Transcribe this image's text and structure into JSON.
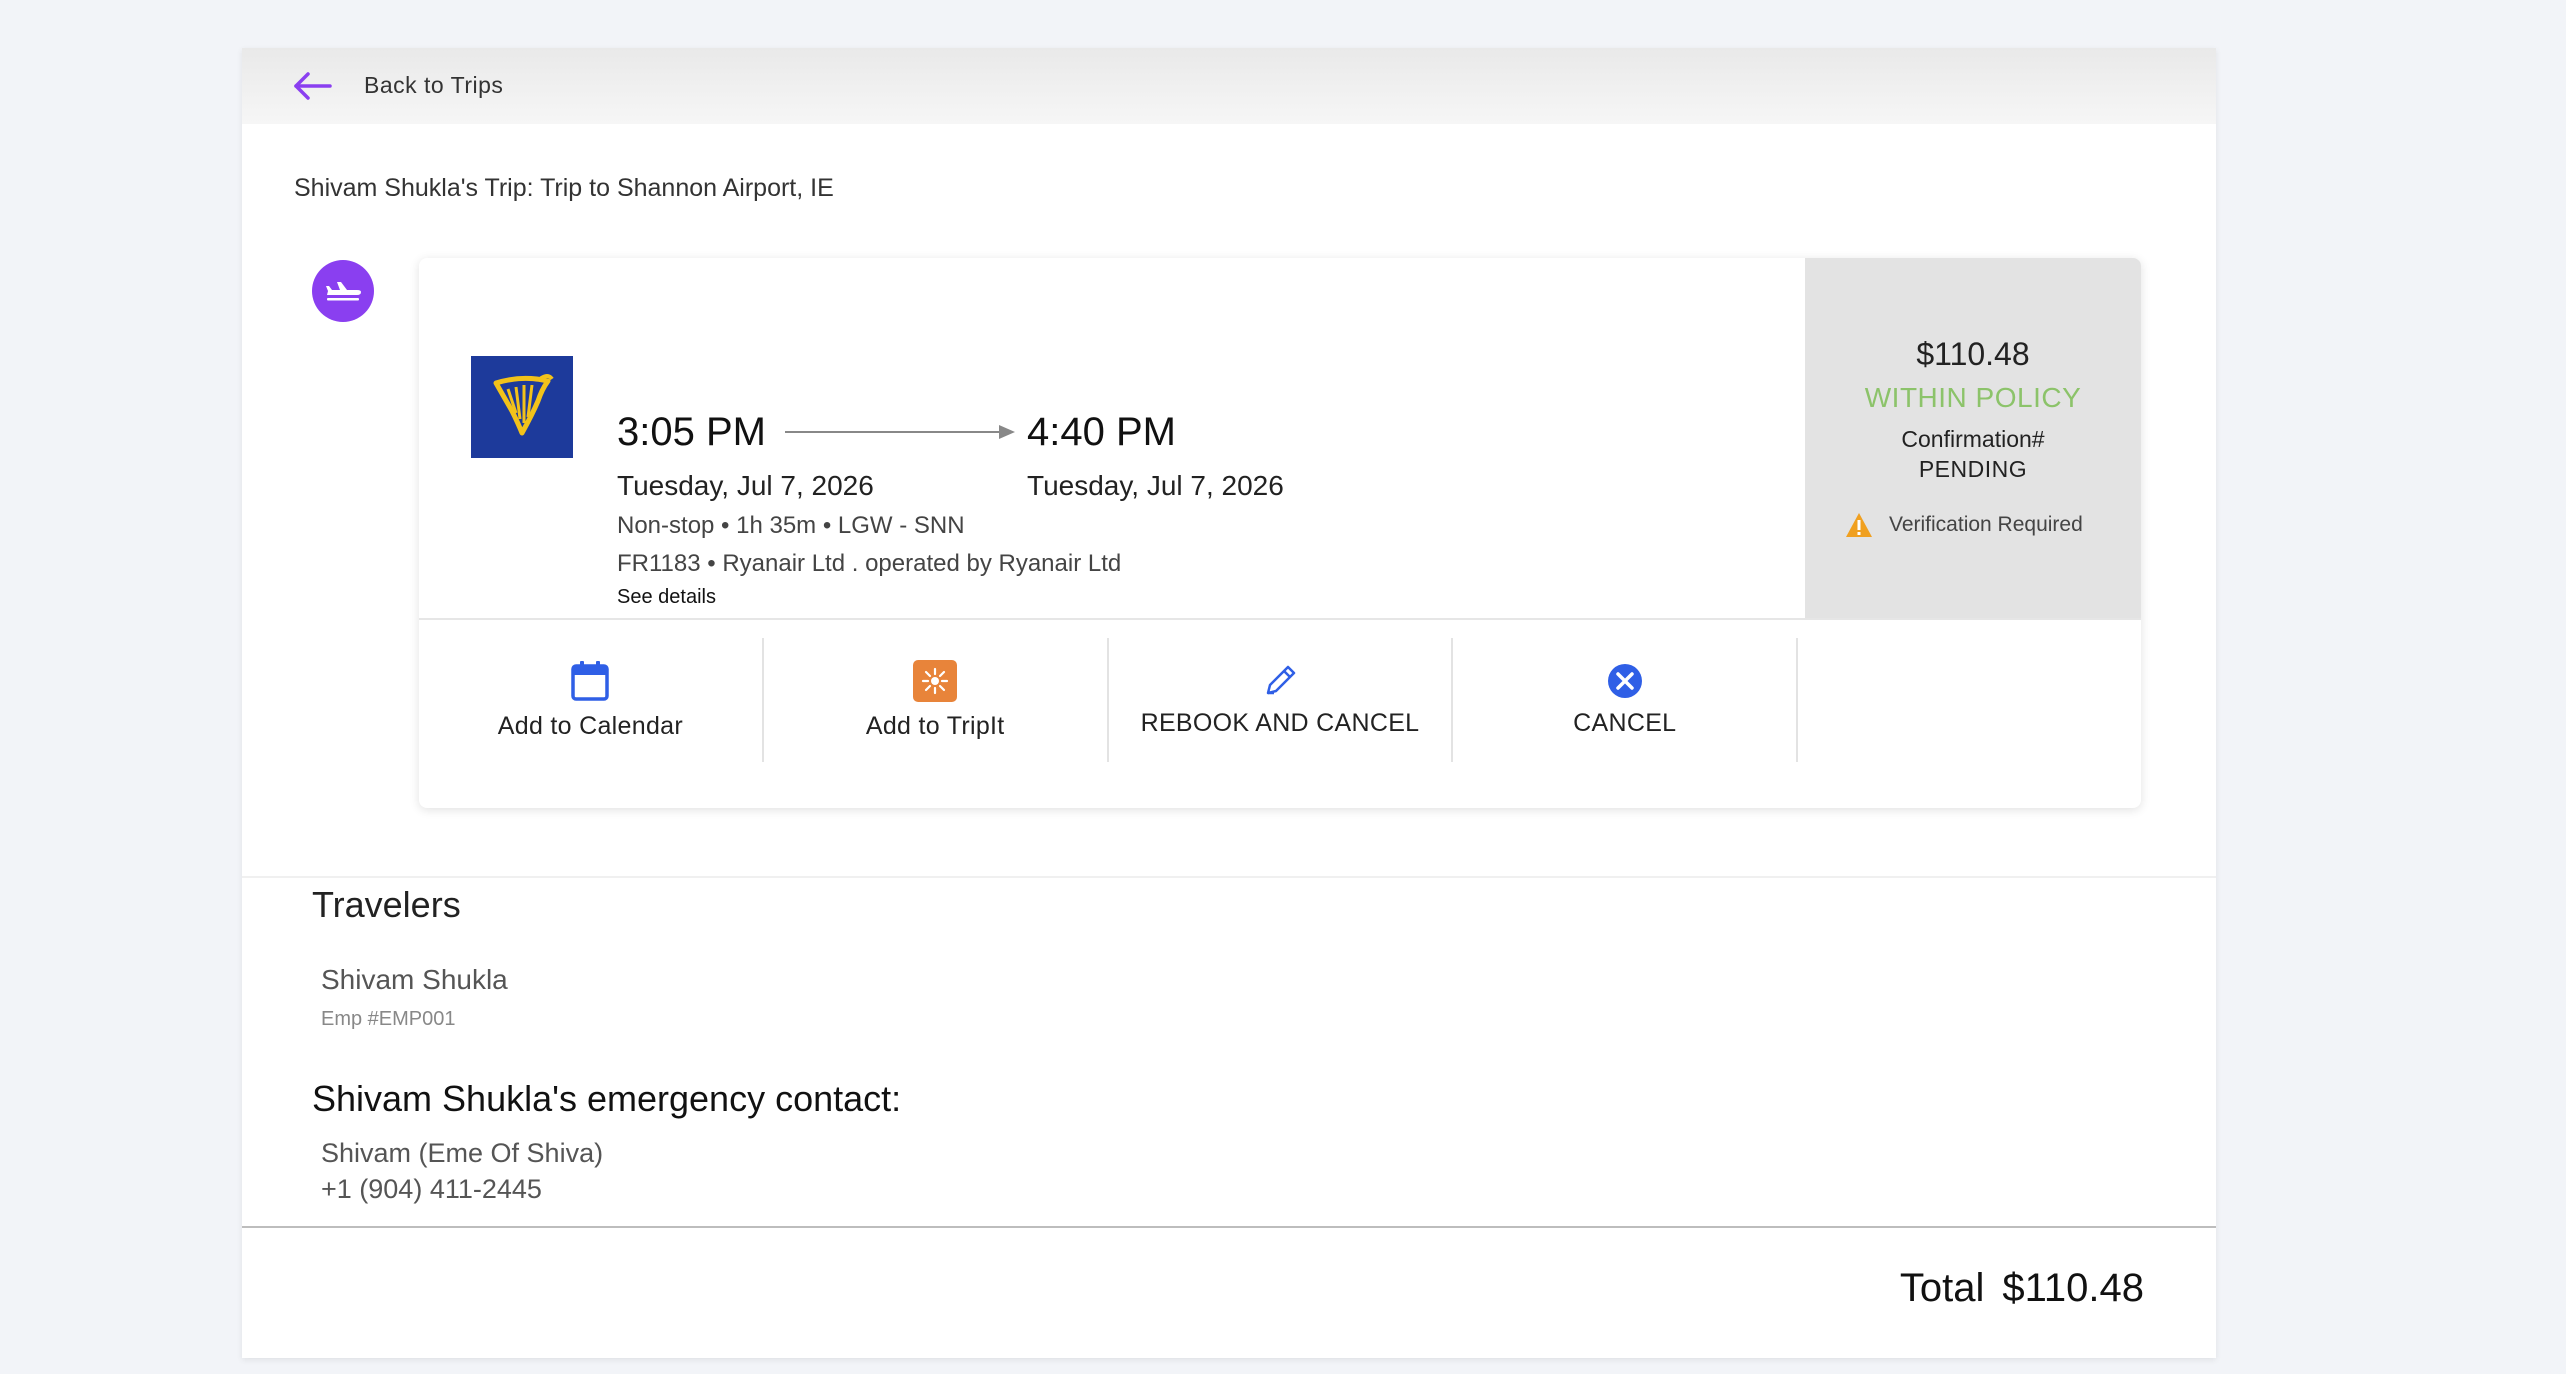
{
  "nav": {
    "back_label": "Back to Trips"
  },
  "trip": {
    "title": "Shivam Shukla's Trip: Trip to Shannon Airport, IE"
  },
  "flight": {
    "departure_time": "3:05 PM",
    "arrival_time": "4:40 PM",
    "departure_date": "Tuesday, Jul 7, 2026",
    "arrival_date": "Tuesday, Jul 7, 2026",
    "stops_duration_route": "Non-stop • 1h 35m • LGW - SNN",
    "flight_carrier": "FR1183 • Ryanair Ltd . operated by Ryanair Ltd",
    "see_details": "See details",
    "airline_logo_icon": "ryanair-harp-icon"
  },
  "summary": {
    "price": "$110.48",
    "policy_status": "WITHIN POLICY",
    "confirmation_label": "Confirmation#",
    "confirmation_value": "PENDING",
    "verification": "Verification Required"
  },
  "actions": [
    {
      "label": "Add to Calendar",
      "icon": "calendar-icon"
    },
    {
      "label": "Add to TripIt",
      "icon": "tripit-icon"
    },
    {
      "label": "REBOOK AND CANCEL",
      "icon": "pencil-icon"
    },
    {
      "label": "CANCEL",
      "icon": "close-circle-icon"
    }
  ],
  "travelers": {
    "title": "Travelers",
    "name": "Shivam Shukla",
    "emp_id": "Emp #EMP001"
  },
  "emergency": {
    "title": "Shivam Shukla's emergency contact:",
    "name": "Shivam (Eme Of Shiva)",
    "phone": "+1 (904) 411-2445"
  },
  "footer": {
    "total_label": "Total",
    "total_value": "$110.48"
  },
  "colors": {
    "accent_purple": "#8a3ff0",
    "policy_green": "#8cc36a",
    "warning_orange": "#f0a020",
    "cancel_blue": "#2f5fe6",
    "tripit_orange": "#e8843a"
  }
}
